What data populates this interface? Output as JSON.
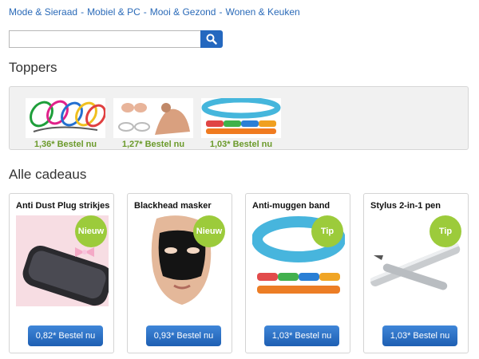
{
  "nav": {
    "links": [
      "Mode & Sieraad",
      "Mobiel & PC",
      "Mooi & Gezond",
      "Wonen & Keuken"
    ],
    "separator": "-"
  },
  "search": {
    "placeholder": "",
    "value": "",
    "icon": "search-icon"
  },
  "toppers": {
    "title": "Toppers",
    "items": [
      {
        "price_label": "1,36* Bestel nu",
        "image": "colorful-earbud-cords"
      },
      {
        "price_label": "1,27* Bestel nu",
        "image": "yoga-toe-separators"
      },
      {
        "price_label": "1,03* Bestel nu",
        "image": "anti-mosquito-bands"
      }
    ]
  },
  "catalog": {
    "title": "Alle cadeaus",
    "items": [
      {
        "name": "Anti Dust Plug strikjes",
        "badge": "Nieuw",
        "button": "0,82* Bestel nu",
        "image": "phone-dust-plug-bow"
      },
      {
        "name": "Blackhead masker",
        "badge": "Nieuw",
        "button": "0,93* Bestel nu",
        "image": "black-face-mask"
      },
      {
        "name": "Anti-muggen band",
        "badge": "Tip",
        "button": "1,03* Bestel nu",
        "image": "blue-wrist-band"
      },
      {
        "name": "Stylus 2-in-1 pen",
        "badge": "Tip",
        "button": "1,03* Bestel nu",
        "image": "silver-stylus-pen"
      }
    ]
  },
  "colors": {
    "link": "#2a6ab8",
    "badge": "#9ccb3b",
    "button": "#2468bf",
    "topper_price": "#6b9a2b"
  }
}
